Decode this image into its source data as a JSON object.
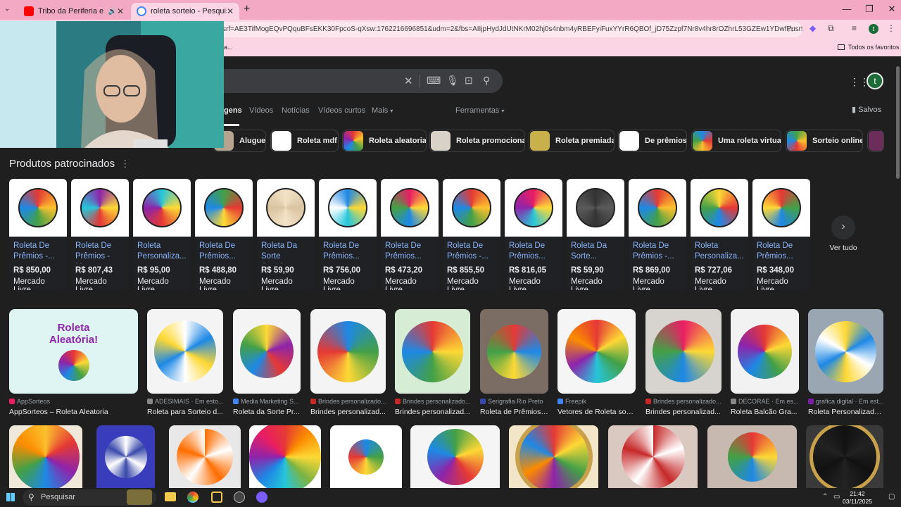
{
  "tabs": [
    {
      "title": "Tribo da Periferia e Hungria",
      "icon": "youtube-icon"
    },
    {
      "title": "roleta sorteio - Pesquisa Google",
      "icon": "google-icon"
    }
  ],
  "new_tab": "+",
  "address": {
    "url": "srf=AE3TifMogEQvPQquBFsEKK30FpcoS-qXsw:1762216696851&udm=2&fbs=AIIjpHydJdUtNKrM02hj0s4nbm4yRBEFyiFuxYYrR6QBOf_jD75Zzpf7Nr8v4hr8rOZhrL53GZEw1YDwfPusr5Oqk12ec_..."
  },
  "bookmarks": {
    "left_fragment": "a...",
    "all_bookmarks": "Todos os favoritos"
  },
  "avatar_letter": "t",
  "nav_tabs": [
    "gens",
    "Vídeos",
    "Notícias",
    "Vídeos curtos",
    "Mais",
    "Ferramentas"
  ],
  "saved_label": "Salvos",
  "chips": [
    "Aluguel",
    "Roleta mdf",
    "Roleta aleatoria",
    "Roleta promocional",
    "Roleta premiada",
    "De prêmios",
    "Uma roleta virtual",
    "Sorteio online"
  ],
  "sponsored": {
    "title": "Produtos patrocinados",
    "see_all": "Ver tudo",
    "products": [
      {
        "name": "Roleta De Prêmios -...",
        "price": "R$ 850,00",
        "store": "Mercado Livre"
      },
      {
        "name": "Roleta De Prêmios - M...",
        "price": "R$ 807,43",
        "store": "Mercado Livre"
      },
      {
        "name": "Roleta Personaliza...",
        "price": "R$ 95,00",
        "store": "Mercado Livre"
      },
      {
        "name": "Roleta De Prêmios...",
        "price": "R$ 488,80",
        "store": "Mercado Livre"
      },
      {
        "name": "Roleta Da Sorte Sortei...",
        "price": "R$ 59,90",
        "store": "Mercado Livre"
      },
      {
        "name": "Roleta De Prêmios...",
        "price": "R$ 756,00",
        "store": "Mercado Livre"
      },
      {
        "name": "Roleta De Prêmios...",
        "price": "R$ 473,20",
        "store": "Mercado Livre"
      },
      {
        "name": "Roleta De Prêmios -...",
        "price": "R$ 855,50",
        "store": "Mercado Livre"
      },
      {
        "name": "Roleta De Prêmios...",
        "price": "R$ 816,05",
        "store": "Mercado Livre"
      },
      {
        "name": "Roleta Da Sorte...",
        "price": "R$ 59,90",
        "store": "Mercado Livre"
      },
      {
        "name": "Roleta De Prêmios -...",
        "price": "R$ 869,00",
        "store": "Mercado Livre"
      },
      {
        "name": "Roleta Personaliza...",
        "price": "R$ 727,06",
        "store": "Mercado Livre"
      },
      {
        "name": "Roleta De Prêmios...",
        "price": "R$ 348,00",
        "store": "Mercado Livre"
      }
    ]
  },
  "results": [
    {
      "source": "AppSorteos",
      "title": "AppSorteos – Roleta Aleatoria",
      "img_text": "Roleta Aleatória!"
    },
    {
      "source": "ADESIMAIS · Em esto...",
      "title": "Roleta para Sorteio d..."
    },
    {
      "source": "Media Marketing S...",
      "title": "Roleta da Sorte Pr..."
    },
    {
      "source": "Brindes personalizado...",
      "title": "Brindes personalizad..."
    },
    {
      "source": "Brindes personalizado...",
      "title": "Brindes personalizad..."
    },
    {
      "source": "Serigrafia Rio Preto",
      "title": "Roleta de Prêmios ..."
    },
    {
      "source": "Freepik",
      "title": "Vetores de Roleta sort..."
    },
    {
      "source": "Brindes personalizado...",
      "title": "Brindes personalizad..."
    },
    {
      "source": "DECORAE · Em es...",
      "title": "Roleta Balcão Gra..."
    },
    {
      "source": "grafica digital · Em est...",
      "title": "Roleta Personalizada..."
    }
  ],
  "taskbar": {
    "search": "Pesquisar",
    "time": "21:42",
    "date": "03/11/2025"
  },
  "colors": {
    "page_bg": "#1f1f1f",
    "tab_strip": "#f3a9c4",
    "link": "#8ab4f8",
    "text": "#e8eaed"
  }
}
